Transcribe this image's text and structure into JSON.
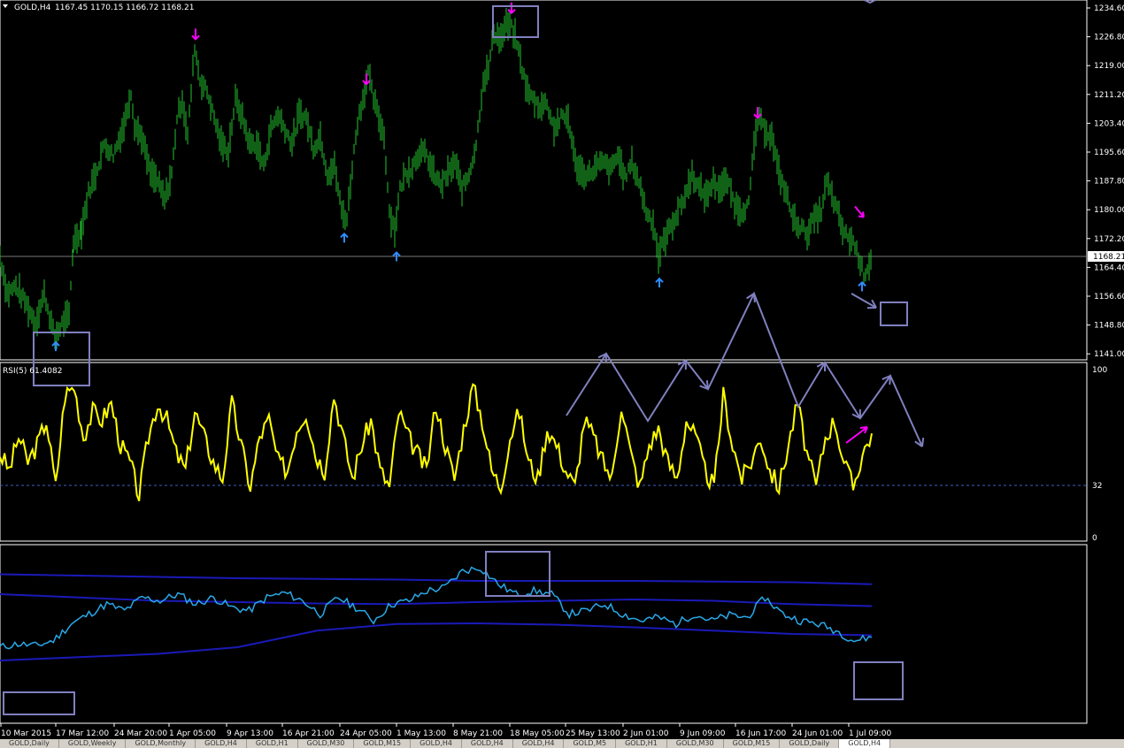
{
  "header": {
    "symbol": "GOLD,H4",
    "ohlc": "1167.45 1170.15 1166.72 1168.21"
  },
  "rsi_label": "RSI(5) 61.4082",
  "price_axis": {
    "ticks": [
      "1234.60",
      "1226.80",
      "1219.00",
      "1211.20",
      "1203.40",
      "1195.60",
      "1187.80",
      "1180.00",
      "1172.20",
      "1164.40",
      "1156.60",
      "1148.80",
      "1141.00"
    ],
    "current": "1168.21"
  },
  "rsi_axis": {
    "ticks": [
      "100",
      "32",
      "0"
    ]
  },
  "time_axis": {
    "ticks": [
      "10 Mar 2015",
      "17 Mar 12:00",
      "24 Mar 20:00",
      "1 Apr 05:00",
      "9 Apr 13:00",
      "16 Apr 21:00",
      "24 Apr 05:00",
      "1 May 13:00",
      "8 May 21:00",
      "18 May 05:00",
      "25 May 13:00",
      "2 Jun 01:00",
      "9 Jun 09:00",
      "16 Jun 17:00",
      "24 Jun 01:00",
      "1 Jul 09:00"
    ]
  },
  "tabs": [
    "GOLD,Daily",
    "GOLD,Weekly",
    "GOLD,Monthly",
    "GOLD,H4",
    "GOLD,H1",
    "GOLD,M30",
    "GOLD,M15",
    "GOLD,H4",
    "GOLD,H4",
    "GOLD,H4",
    "GOLD,M5",
    "GOLD,H1",
    "GOLD,M30",
    "GOLD,M15",
    "GOLD,Daily",
    "GOLD,H4"
  ],
  "colors": {
    "price": "#22c32e",
    "rsi": "#ffff00",
    "osc": "#29a8e8",
    "bands": "#1a1ab8",
    "annot": "#8080c0",
    "up_arrow": "#2f8cff",
    "down_arrow": "#ff00ff"
  },
  "chart_data": [
    {
      "type": "bar",
      "ylim": [
        1141.0,
        1234.6
      ],
      "price_path": [
        [
          0,
          1168
        ],
        [
          8,
          1158
        ],
        [
          18,
          1160
        ],
        [
          30,
          1155
        ],
        [
          40,
          1150
        ],
        [
          50,
          1158
        ],
        [
          62,
          1146
        ],
        [
          70,
          1150
        ],
        [
          78,
          1152
        ],
        [
          83,
          1172
        ],
        [
          92,
          1175
        ],
        [
          100,
          1185
        ],
        [
          108,
          1190
        ],
        [
          118,
          1198
        ],
        [
          128,
          1195
        ],
        [
          140,
          1203
        ],
        [
          148,
          1212
        ],
        [
          152,
          1203
        ],
        [
          160,
          1200
        ],
        [
          170,
          1190
        ],
        [
          178,
          1188
        ],
        [
          186,
          1183
        ],
        [
          194,
          1190
        ],
        [
          200,
          1205
        ],
        [
          206,
          1210
        ],
        [
          212,
          1200
        ],
        [
          220,
          1224
        ],
        [
          226,
          1215
        ],
        [
          234,
          1212
        ],
        [
          242,
          1205
        ],
        [
          250,
          1198
        ],
        [
          258,
          1196
        ],
        [
          266,
          1210
        ],
        [
          274,
          1205
        ],
        [
          282,
          1198
        ],
        [
          290,
          1198
        ],
        [
          298,
          1192
        ],
        [
          306,
          1202
        ],
        [
          314,
          1206
        ],
        [
          322,
          1202
        ],
        [
          330,
          1198
        ],
        [
          338,
          1206
        ],
        [
          346,
          1205
        ],
        [
          354,
          1197
        ],
        [
          362,
          1200
        ],
        [
          370,
          1190
        ],
        [
          378,
          1192
        ],
        [
          386,
          1180
        ],
        [
          392,
          1178
        ],
        [
          398,
          1192
        ],
        [
          404,
          1204
        ],
        [
          410,
          1210
        ],
        [
          416,
          1217
        ],
        [
          422,
          1210
        ],
        [
          428,
          1205
        ],
        [
          434,
          1200
        ],
        [
          440,
          1180
        ],
        [
          446,
          1175
        ],
        [
          452,
          1186
        ],
        [
          458,
          1190
        ],
        [
          466,
          1192
        ],
        [
          474,
          1196
        ],
        [
          482,
          1195
        ],
        [
          490,
          1190
        ],
        [
          498,
          1187
        ],
        [
          506,
          1190
        ],
        [
          514,
          1193
        ],
        [
          522,
          1186
        ],
        [
          530,
          1190
        ],
        [
          538,
          1198
        ],
        [
          546,
          1215
        ],
        [
          552,
          1218
        ],
        [
          558,
          1228
        ],
        [
          566,
          1226
        ],
        [
          572,
          1230
        ],
        [
          578,
          1229
        ],
        [
          584,
          1225
        ],
        [
          590,
          1218
        ],
        [
          596,
          1212
        ],
        [
          602,
          1210
        ],
        [
          610,
          1208
        ],
        [
          618,
          1209
        ],
        [
          626,
          1202
        ],
        [
          634,
          1205
        ],
        [
          642,
          1205
        ],
        [
          650,
          1193
        ],
        [
          658,
          1190
        ],
        [
          666,
          1190
        ],
        [
          674,
          1192
        ],
        [
          682,
          1193
        ],
        [
          690,
          1191
        ],
        [
          698,
          1195
        ],
        [
          706,
          1189
        ],
        [
          714,
          1193
        ],
        [
          722,
          1188
        ],
        [
          730,
          1180
        ],
        [
          738,
          1177
        ],
        [
          744,
          1168
        ],
        [
          750,
          1172
        ],
        [
          758,
          1176
        ],
        [
          766,
          1180
        ],
        [
          774,
          1184
        ],
        [
          782,
          1190
        ],
        [
          790,
          1186
        ],
        [
          798,
          1184
        ],
        [
          806,
          1188
        ],
        [
          814,
          1186
        ],
        [
          822,
          1188
        ],
        [
          830,
          1182
        ],
        [
          838,
          1180
        ],
        [
          846,
          1182
        ],
        [
          852,
          1197
        ],
        [
          856,
          1205
        ],
        [
          864,
          1202
        ],
        [
          872,
          1200
        ],
        [
          880,
          1190
        ],
        [
          888,
          1185
        ],
        [
          896,
          1178
        ],
        [
          904,
          1176
        ],
        [
          912,
          1174
        ],
        [
          920,
          1178
        ],
        [
          928,
          1180
        ],
        [
          934,
          1188
        ],
        [
          940,
          1184
        ],
        [
          946,
          1180
        ],
        [
          952,
          1175
        ],
        [
          958,
          1173
        ],
        [
          964,
          1172
        ],
        [
          970,
          1168
        ],
        [
          976,
          1163
        ],
        [
          982,
          1166
        ],
        [
          986,
          1168
        ]
      ],
      "signals": {
        "down": [
          [
            221,
            1226
          ],
          [
            414,
            1214
          ],
          [
            578,
            1233
          ],
          [
            856,
            1205
          ],
          [
            974,
            1178
          ]
        ],
        "up": [
          [
            63,
            1145
          ],
          [
            389,
            1174
          ],
          [
            448,
            1169
          ],
          [
            745,
            1162
          ],
          [
            974,
            1161
          ]
        ]
      }
    },
    {
      "type": "line",
      "series": [
        {
          "name": "RSI(5)",
          "values": [
            50,
            40,
            60,
            45,
            55,
            70,
            30,
            85,
            90,
            60,
            75,
            70,
            80,
            55,
            45,
            25,
            60,
            80,
            70,
            50,
            40,
            75,
            60,
            45,
            35,
            80,
            55,
            30,
            60,
            70,
            45,
            40,
            65,
            75,
            50,
            40,
            85,
            60,
            35,
            55,
            70,
            40,
            30,
            75,
            60,
            50,
            40,
            80,
            55,
            35,
            65,
            90,
            70,
            40,
            30,
            60,
            75,
            45,
            35,
            65,
            55,
            40,
            30,
            70,
            60,
            45,
            35,
            80,
            50,
            30,
            55,
            65,
            45,
            35,
            70,
            60,
            40,
            30,
            85,
            55,
            35,
            45,
            60,
            40,
            30,
            55,
            80,
            50,
            30,
            60,
            70,
            45,
            30,
            50,
            62
          ]
        }
      ],
      "ylim": [
        0,
        100
      ],
      "level": 32
    },
    {
      "type": "line",
      "series": [
        {
          "name": "",
          "values": [
            -0.2,
            -0.15,
            -0.18,
            -0.1,
            0.15,
            0.3,
            0.45,
            0.35,
            0.55,
            0.5,
            0.6,
            0.45,
            0.55,
            0.4,
            0.35,
            0.55,
            0.62,
            0.5,
            0.3,
            0.55,
            0.4,
            0.2,
            0.45,
            0.5,
            0.65,
            0.7,
            0.95,
            1.0,
            0.75,
            0.6,
            0.65,
            0.6,
            0.3,
            0.35,
            0.45,
            0.3,
            0.2,
            0.25,
            0.15,
            0.3,
            0.2,
            0.28,
            0.25,
            0.55,
            0.3,
            0.2,
            0.15,
            0.05,
            -0.1,
            -0.05
          ]
        },
        {
          "name": "",
          "values": [
            0.9,
            0.88,
            0.86,
            0.84,
            0.83,
            0.82,
            0.8,
            0.8,
            0.8,
            0.79,
            0.78,
            0.75
          ]
        },
        {
          "name": "",
          "values": [
            0.6,
            0.55,
            0.5,
            0.48,
            0.46,
            0.45,
            0.48,
            0.5,
            0.52,
            0.5,
            0.45,
            0.42
          ]
        },
        {
          "name": "",
          "values": [
            -0.4,
            -0.35,
            -0.3,
            -0.2,
            0.05,
            0.15,
            0.16,
            0.14,
            0.1,
            0.05,
            0.0,
            -0.02
          ]
        }
      ]
    }
  ]
}
